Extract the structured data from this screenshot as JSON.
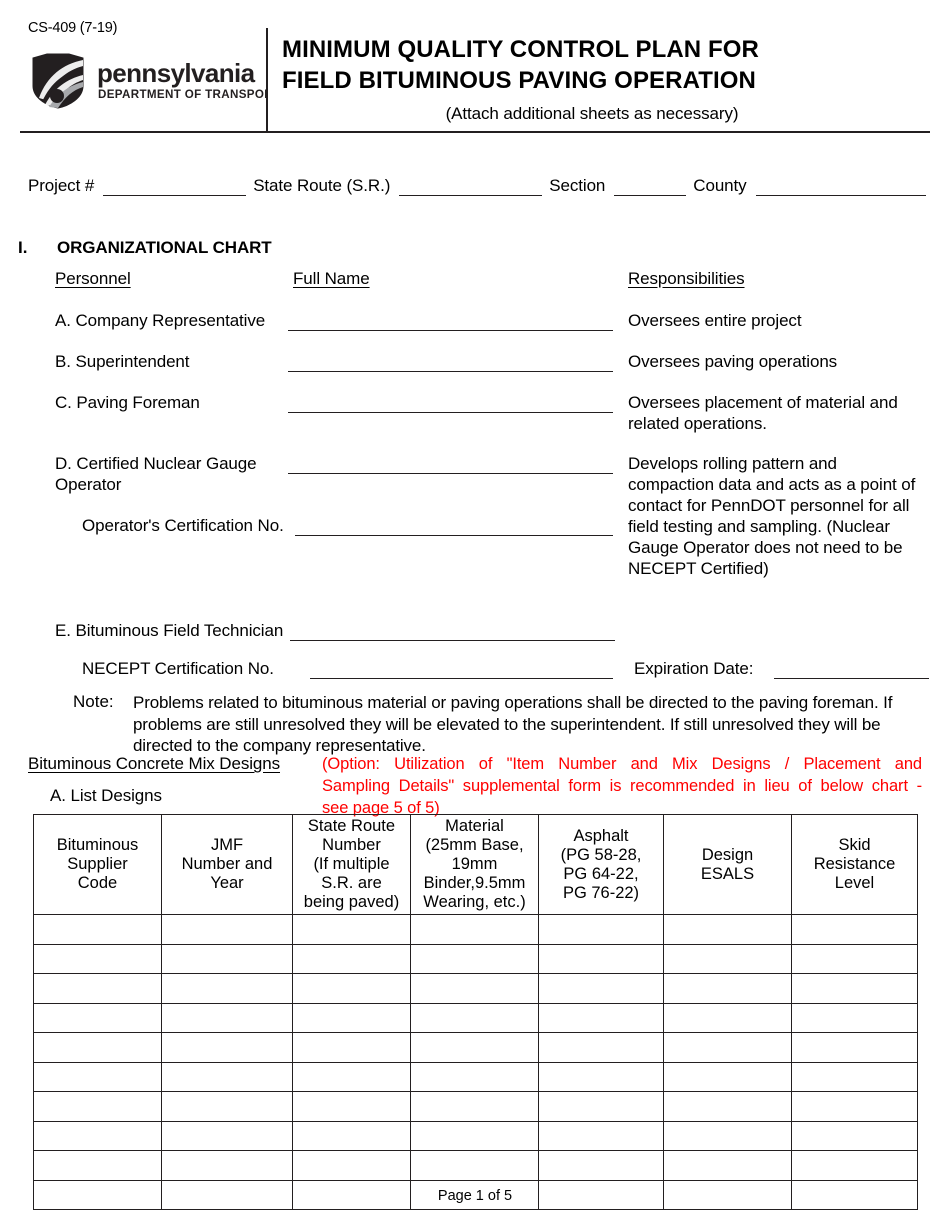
{
  "form": {
    "form_number": "CS-409 (7-19)",
    "agency_name": "pennsylvania",
    "agency_subtitle": "DEPARTMENT OF TRANSPORTATION",
    "title_line1": "MINIMUM QUALITY CONTROL PLAN FOR",
    "title_line2": "FIELD BITUMINOUS PAVING OPERATION",
    "subtitle": "(Attach additional sheets as necessary)",
    "footer": "Page 1 of 5"
  },
  "project_line": {
    "project_label": "Project #",
    "state_route_label": "State Route (S.R.)",
    "section_label": "Section",
    "county_label": "County"
  },
  "section_one": {
    "numeral": "I.",
    "title": "ORGANIZATIONAL CHART",
    "col_personnel": "Personnel",
    "col_full_name": "Full Name",
    "col_responsibilities": "Responsibilities",
    "rows": [
      {
        "label": "A. Company Representative",
        "responsibility": "Oversees entire project"
      },
      {
        "label": "B. Superintendent",
        "responsibility": "Oversees paving operations"
      },
      {
        "label": "C. Paving Foreman",
        "responsibility": "Oversees placement of material and related operations."
      },
      {
        "label": "D. Certified Nuclear Gauge\nOperator",
        "responsibility": "Develops rolling pattern and compaction data and acts as a point of contact for PennDOT personnel for all field testing and sampling. (Nuclear Gauge Operator does not need to be NECEPT Certified)"
      }
    ],
    "operator_cert_label": "Operator's Certification No.",
    "tech_label": "E.  Bituminous Field Technician",
    "necept_label": "NECEPT Certification No.",
    "expiration_label": "Expiration Date:"
  },
  "note": {
    "label": "Note:",
    "text": "Problems related to bituminous material or paving operations shall be directed to the paving foreman.  If problems are still unresolved they will be elevated to the superintendent.  If still unresolved they will be directed to the company representative."
  },
  "mix_designs": {
    "heading": "Bituminous Concrete Mix Designs",
    "subheading": "A. List Designs",
    "option_note_color": "#ff0000",
    "option_note_line1": "(Option:    Utilization of \"Item Number and Mix Designs / Placement and",
    "option_note_line2": "Sampling Details\" supplemental form is recommended in lieu of below chart -",
    "option_note_line3": "see page 5 of 5)",
    "table": {
      "columns": [
        [
          "Bituminous",
          "Supplier",
          "Code"
        ],
        [
          "JMF",
          "Number and",
          "Year"
        ],
        [
          "State Route",
          "Number",
          "(If multiple",
          "S.R. are",
          "being paved)"
        ],
        [
          "Material",
          "(25mm Base,",
          "19mm",
          "Binder,9.5mm",
          "Wearing, etc.)"
        ],
        [
          "Asphalt",
          "(PG 58-28,",
          "PG 64-22,",
          "PG 76-22)"
        ],
        [
          "Design",
          "ESALS"
        ],
        [
          "Skid",
          "Resistance",
          "Level"
        ]
      ],
      "empty_row_count": 10
    }
  }
}
